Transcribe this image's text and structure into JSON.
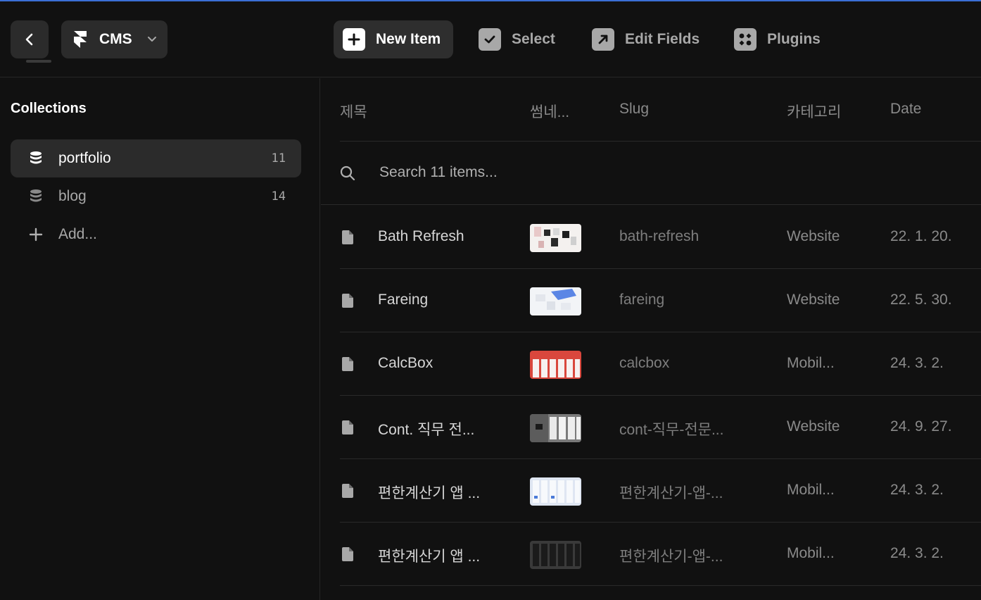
{
  "toolbar": {
    "back_icon": "chevron-left-icon",
    "project": {
      "label": "CMS",
      "icon": "framer-logo-icon",
      "chevron": "chevron-down-icon"
    },
    "new_item": {
      "label": "New Item",
      "icon": "plus-icon"
    },
    "select": {
      "label": "Select",
      "icon": "checkbox-icon"
    },
    "edit_fields": {
      "label": "Edit Fields",
      "icon": "arrow-up-right-icon"
    },
    "plugins": {
      "label": "Plugins",
      "icon": "plugins-icon"
    }
  },
  "sidebar": {
    "title": "Collections",
    "items": [
      {
        "name": "portfolio",
        "count": "11",
        "icon": "database-icon",
        "active": true
      },
      {
        "name": "blog",
        "count": "14",
        "icon": "database-icon",
        "active": false
      }
    ],
    "add_label": "Add..."
  },
  "table": {
    "headers": {
      "title": "제목",
      "thumbnail": "썸네...",
      "slug": "Slug",
      "category": "카테고리",
      "date": "Date"
    },
    "search_placeholder": "Search 11 items...",
    "rows": [
      {
        "title": "Bath Refresh",
        "slug": "bath-refresh",
        "category": "Website",
        "date": "22. 1. 20."
      },
      {
        "title": "Fareing",
        "slug": "fareing",
        "category": "Website",
        "date": "22. 5. 30."
      },
      {
        "title": "CalcBox",
        "slug": "calcbox",
        "category": "Mobil...",
        "date": "24. 3. 2."
      },
      {
        "title": "Cont. 직무 전...",
        "slug": "cont-직무-전문...",
        "category": "Website",
        "date": "24. 9. 27."
      },
      {
        "title": "편한계산기 앱 ...",
        "slug": "편한계산기-앱-...",
        "category": "Mobil...",
        "date": "24. 3. 2."
      },
      {
        "title": "편한계산기 앱 ...",
        "slug": "편한계산기-앱-...",
        "category": "Mobil...",
        "date": "24. 3. 2."
      }
    ]
  },
  "colors": {
    "background": "#111111",
    "panel": "#2b2b2b",
    "accent_line": "#3b6fd6",
    "muted_text": "#a8a8a8"
  }
}
